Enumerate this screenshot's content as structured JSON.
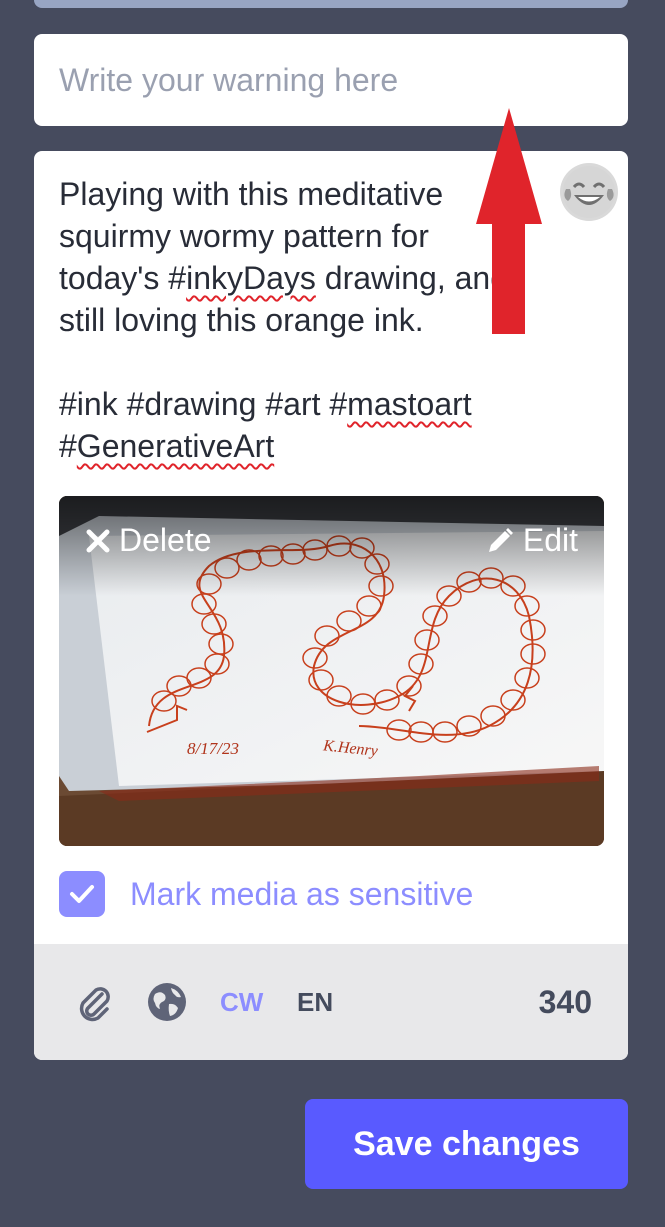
{
  "content_warning": {
    "placeholder": "Write your warning here"
  },
  "status": {
    "line1": "Playing with this meditative",
    "line2": "squirmy wormy pattern for",
    "line3_pre": "today's #",
    "line3_tag": "inkyDays",
    "line3_post": " drawing, and",
    "line4": "still loving this orange ink.",
    "line6_pre": "#ink #drawing #art #",
    "line6_tag": "mastoart",
    "line7_pre": "#",
    "line7_tag": "GenerativeArt"
  },
  "emoji_icon": "tears-of-joy-emoji-icon",
  "media": {
    "delete_label": "Delete",
    "edit_label": "Edit",
    "delete_icon": "close-icon",
    "edit_icon": "pencil-icon",
    "annotation_date": "8/17/23",
    "annotation_signature": "K.Henry"
  },
  "sensitive": {
    "label": "Mark media as sensitive",
    "checked": true
  },
  "footer": {
    "attach_icon": "paperclip-icon",
    "privacy_icon": "globe-icon",
    "cw_label": "CW",
    "language_label": "EN",
    "char_count": "340"
  },
  "save_label": "Save changes",
  "colors": {
    "accent": "#595aff",
    "accent_light": "#8c8dff",
    "background": "#464b5e",
    "arrow": "#e0242b"
  }
}
